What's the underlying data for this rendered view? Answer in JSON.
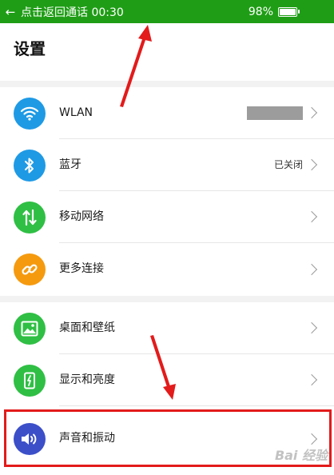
{
  "status_bar": {
    "back_glyph": "←",
    "call_text": "点击返回通话 00:30",
    "battery": "98%"
  },
  "header": {
    "title": "设置"
  },
  "groups": [
    {
      "items": [
        {
          "label": "WLAN",
          "value": "",
          "icon": "wifi-icon",
          "color": "#1e9ae5"
        },
        {
          "label": "蓝牙",
          "value": "已关闭",
          "icon": "bluetooth-icon",
          "color": "#1e9ae5"
        },
        {
          "label": "移动网络",
          "value": "",
          "icon": "mobile-network-icon",
          "color": "#2fbf44"
        },
        {
          "label": "更多连接",
          "value": "",
          "icon": "link-icon",
          "color": "#f59a0f"
        }
      ]
    },
    {
      "items": [
        {
          "label": "桌面和壁纸",
          "value": "",
          "icon": "wallpaper-icon",
          "color": "#2fbf44"
        },
        {
          "label": "显示和亮度",
          "value": "",
          "icon": "display-brightness-icon",
          "color": "#2fbf44"
        },
        {
          "label": "声音和振动",
          "value": "",
          "icon": "sound-icon",
          "color": "#3c4fc9"
        }
      ]
    }
  ],
  "annotations": {
    "color": "#e31b1b"
  },
  "watermark": "Bai 经验"
}
